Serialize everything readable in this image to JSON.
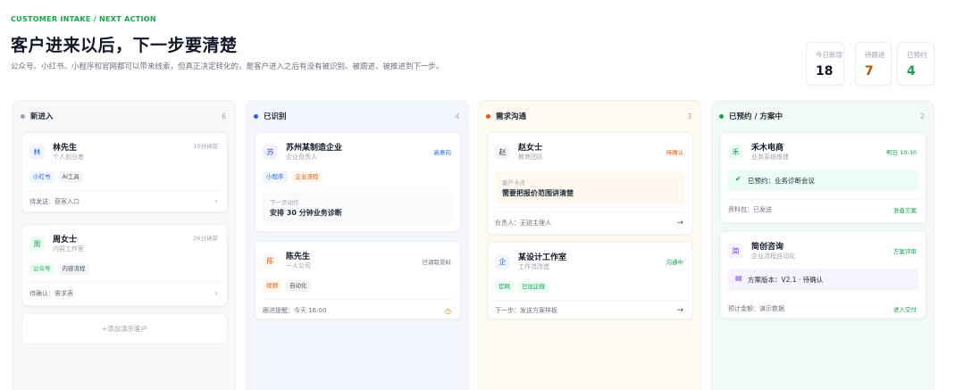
{
  "header": {
    "eyebrow": "CUSTOMER INTAKE / NEXT ACTION",
    "title": "客户进来以后，下一步要清楚",
    "subtitle": "公众号、小红书、小程序和官网都可以带来线索，但真正决定转化的，是客户进入之后有没有被识别、被跟进、被推进到下一步。"
  },
  "stats": [
    {
      "label": "今日新增",
      "value": "18",
      "color": "#111827"
    },
    {
      "label": "待跟进",
      "value": "7",
      "color": "#b45309"
    },
    {
      "label": "已预约",
      "value": "4",
      "color": "#16a34a"
    }
  ],
  "columns": [
    {
      "title": "新进入",
      "count": "6",
      "dot": "#9ca3af",
      "cards": [
        {
          "avatar": "林",
          "name": "林先生",
          "sub": "个人创业者",
          "corner": "10分钟前",
          "tags": [
            "小红书",
            "AI工具"
          ],
          "footer": "待发送：获客入口"
        },
        {
          "avatar": "周",
          "name": "周女士",
          "sub": "内容工作室",
          "corner": "26分钟前",
          "tags": [
            "公众号",
            "内容流程"
          ],
          "footer": "待确认：需求表"
        }
      ],
      "add_label": "+添加演示客户"
    },
    {
      "title": "已识别",
      "count": "4",
      "dot": "#2563eb",
      "cards": [
        {
          "avatar": "苏",
          "name": "苏州某制造企业",
          "sub": "企业负责人",
          "corner": "高意向",
          "tags": [
            "小程序",
            "企业流程"
          ],
          "box_key": "下一步动作",
          "box_value": "安排 30 分钟业务诊断"
        },
        {
          "avatar": "陈",
          "name": "陈先生",
          "sub": "一人公司",
          "corner": "已调取资料",
          "tags": [
            "视频",
            "自动化"
          ],
          "footer": "跟进提醒：今天 16:00"
        }
      ]
    },
    {
      "title": "需求沟通",
      "count": "3",
      "dot": "#ea580c",
      "cards": [
        {
          "avatar": "赵",
          "name": "赵女士",
          "sub": "教育团队",
          "corner": "待确认",
          "box_key": "客户卡点",
          "box_value": "需要把报价范围讲清楚",
          "footer": "负责人：无锐主理人"
        },
        {
          "avatar": "企",
          "name": "某设计工作室",
          "sub": "工作流改造",
          "corner": "沟通中",
          "tags": [
            "官网",
            "已加企微"
          ],
          "footer": "下一步：发送方案样板"
        }
      ]
    },
    {
      "title": "已预约 / 方案中",
      "count": "2",
      "dot": "#16a34a",
      "cards": [
        {
          "avatar": "禾",
          "name": "禾木电商",
          "sub": "业务系统搭建",
          "corner": "明日 10:30",
          "box_value": "已预约：业务诊断会议",
          "footer_left": "资料包：已发送",
          "footer_right": "准备方案"
        },
        {
          "avatar": "简",
          "name": "简创咨询",
          "sub": "企业流程自动化",
          "corner": "方案评审",
          "box_value": "方案版本：V2.1 · 待确认",
          "footer_left": "预计金额：演示数据",
          "footer_right": "进入交付"
        }
      ]
    }
  ],
  "colors": {
    "accent": "#16a34a",
    "blue": "#2563eb",
    "orange": "#ea580c"
  }
}
